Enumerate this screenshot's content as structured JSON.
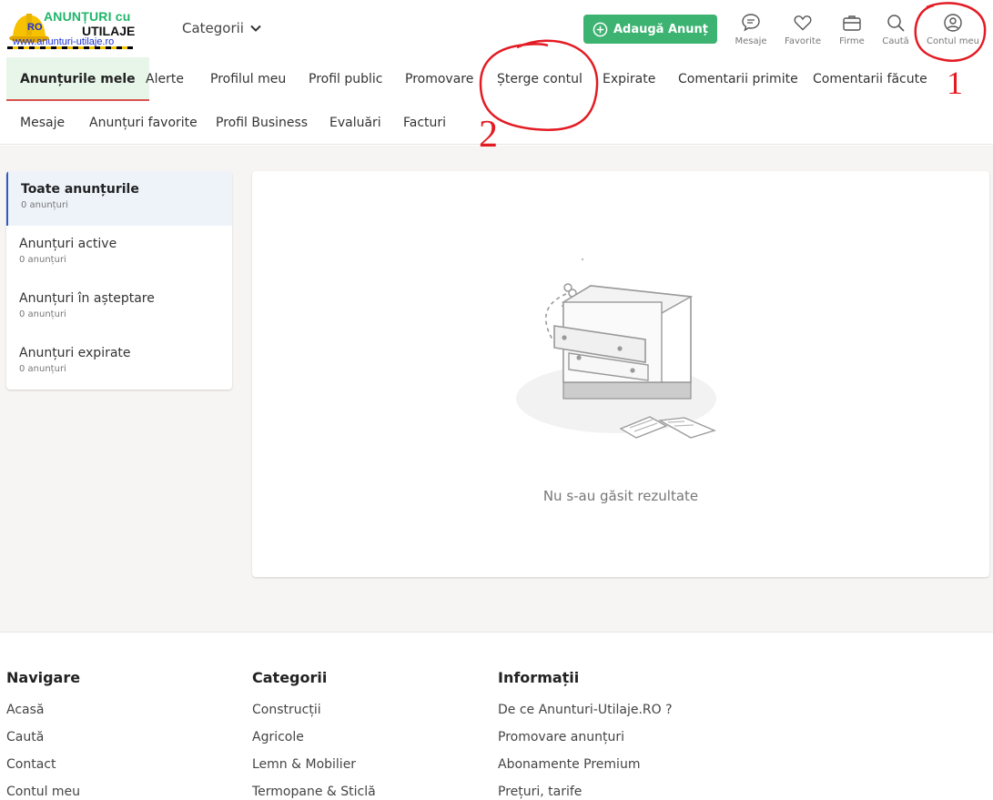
{
  "logo": {
    "line1": "ANUNȚURI cu",
    "line2": "UTILAJE",
    "badge": "RO",
    "url": "www.anunturi-utilaje.ro"
  },
  "header": {
    "categories_label": "Categorii",
    "add_button_label": "Adaugă Anunț",
    "icons": [
      {
        "name": "messages-icon",
        "label": "Mesaje"
      },
      {
        "name": "heart-icon",
        "label": "Favorite"
      },
      {
        "name": "briefcase-icon",
        "label": "Firme"
      },
      {
        "name": "search-icon",
        "label": "Caută"
      },
      {
        "name": "user-circle-icon",
        "label": "Contul meu"
      }
    ],
    "accent_color": "#3cb371"
  },
  "annotations": {
    "mark_1": "1",
    "mark_2": "2",
    "color": "#e31b23"
  },
  "tabs": {
    "row1": [
      "Anunțurile mele",
      "Alerte",
      "Profilul meu",
      "Profil public",
      "Promovare",
      "Șterge contul",
      "Expirate",
      "Comentarii primite",
      "Comentarii făcute"
    ],
    "row2": [
      "Mesaje",
      "Anunțuri favorite",
      "Profil Business",
      "Evaluări",
      "Facturi"
    ],
    "active": "Anunțurile mele"
  },
  "sidebar": {
    "items": [
      {
        "label": "Toate anunțurile",
        "count": "0 anunțuri"
      },
      {
        "label": "Anunțuri active",
        "count": "0 anunțuri"
      },
      {
        "label": "Anunțuri în așteptare",
        "count": "0 anunțuri"
      },
      {
        "label": "Anunțuri expirate",
        "count": "0 anunțuri"
      }
    ]
  },
  "content": {
    "empty_message": "Nu s-au găsit rezultate"
  },
  "footer": {
    "columns": [
      {
        "title": "Navigare",
        "links": [
          "Acasă",
          "Caută",
          "Contact",
          "Contul meu"
        ]
      },
      {
        "title": "Categorii",
        "links": [
          "Construcții",
          "Agricole",
          "Lemn & Mobilier",
          "Termopane & Sticlă"
        ]
      },
      {
        "title": "Informații",
        "links": [
          "De ce Anunturi-Utilaje.RO ?",
          "Promovare anunțuri",
          "Abonamente Premium",
          "Prețuri, tarife"
        ]
      }
    ]
  }
}
